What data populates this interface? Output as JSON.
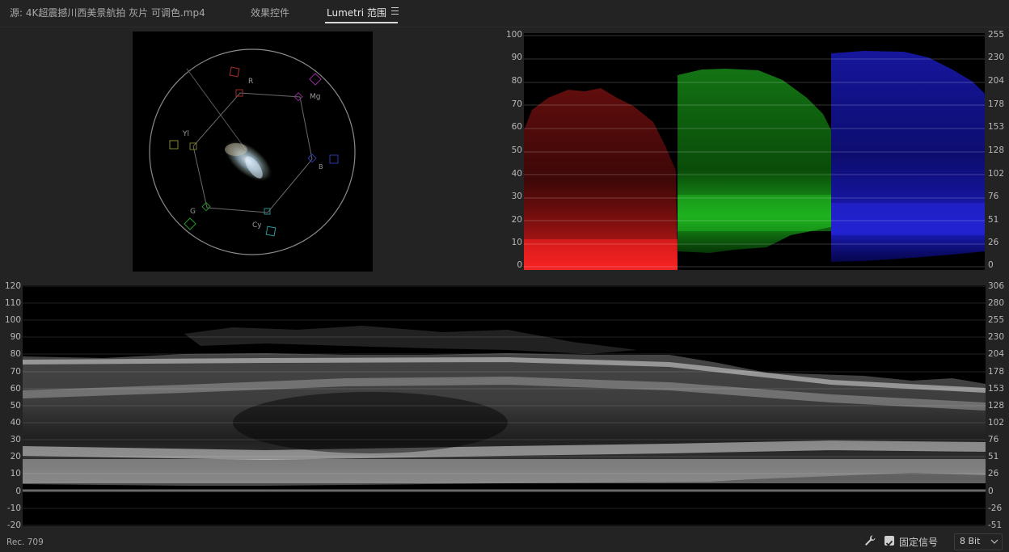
{
  "tabs": {
    "source": "源: 4K超震撼川西美景航拍 灰片 可调色.mp4",
    "effects": "效果控件",
    "lumetri": "Lumetri 范围"
  },
  "vectorscope": {
    "labels": [
      "R",
      "Mg",
      "B",
      "Cy",
      "G",
      "Yl"
    ]
  },
  "parade": {
    "left_scale": [
      "100",
      "90",
      "80",
      "70",
      "60",
      "50",
      "40",
      "30",
      "20",
      "10",
      "0"
    ],
    "right_scale": [
      "255",
      "230",
      "204",
      "178",
      "153",
      "128",
      "102",
      "76",
      "51",
      "26",
      "0"
    ]
  },
  "waveform": {
    "left_scale": [
      "120",
      "110",
      "100",
      "90",
      "80",
      "70",
      "60",
      "50",
      "40",
      "30",
      "20",
      "10",
      "0",
      "-10",
      "-20"
    ],
    "right_scale": [
      "306",
      "280",
      "255",
      "230",
      "204",
      "178",
      "153",
      "128",
      "102",
      "76",
      "51",
      "26",
      "0",
      "-26",
      "-51"
    ]
  },
  "footer": {
    "colorspace": "Rec. 709",
    "clamp_label": "固定信号",
    "clamp_checked": true,
    "bit_depth": "8 Bit"
  }
}
